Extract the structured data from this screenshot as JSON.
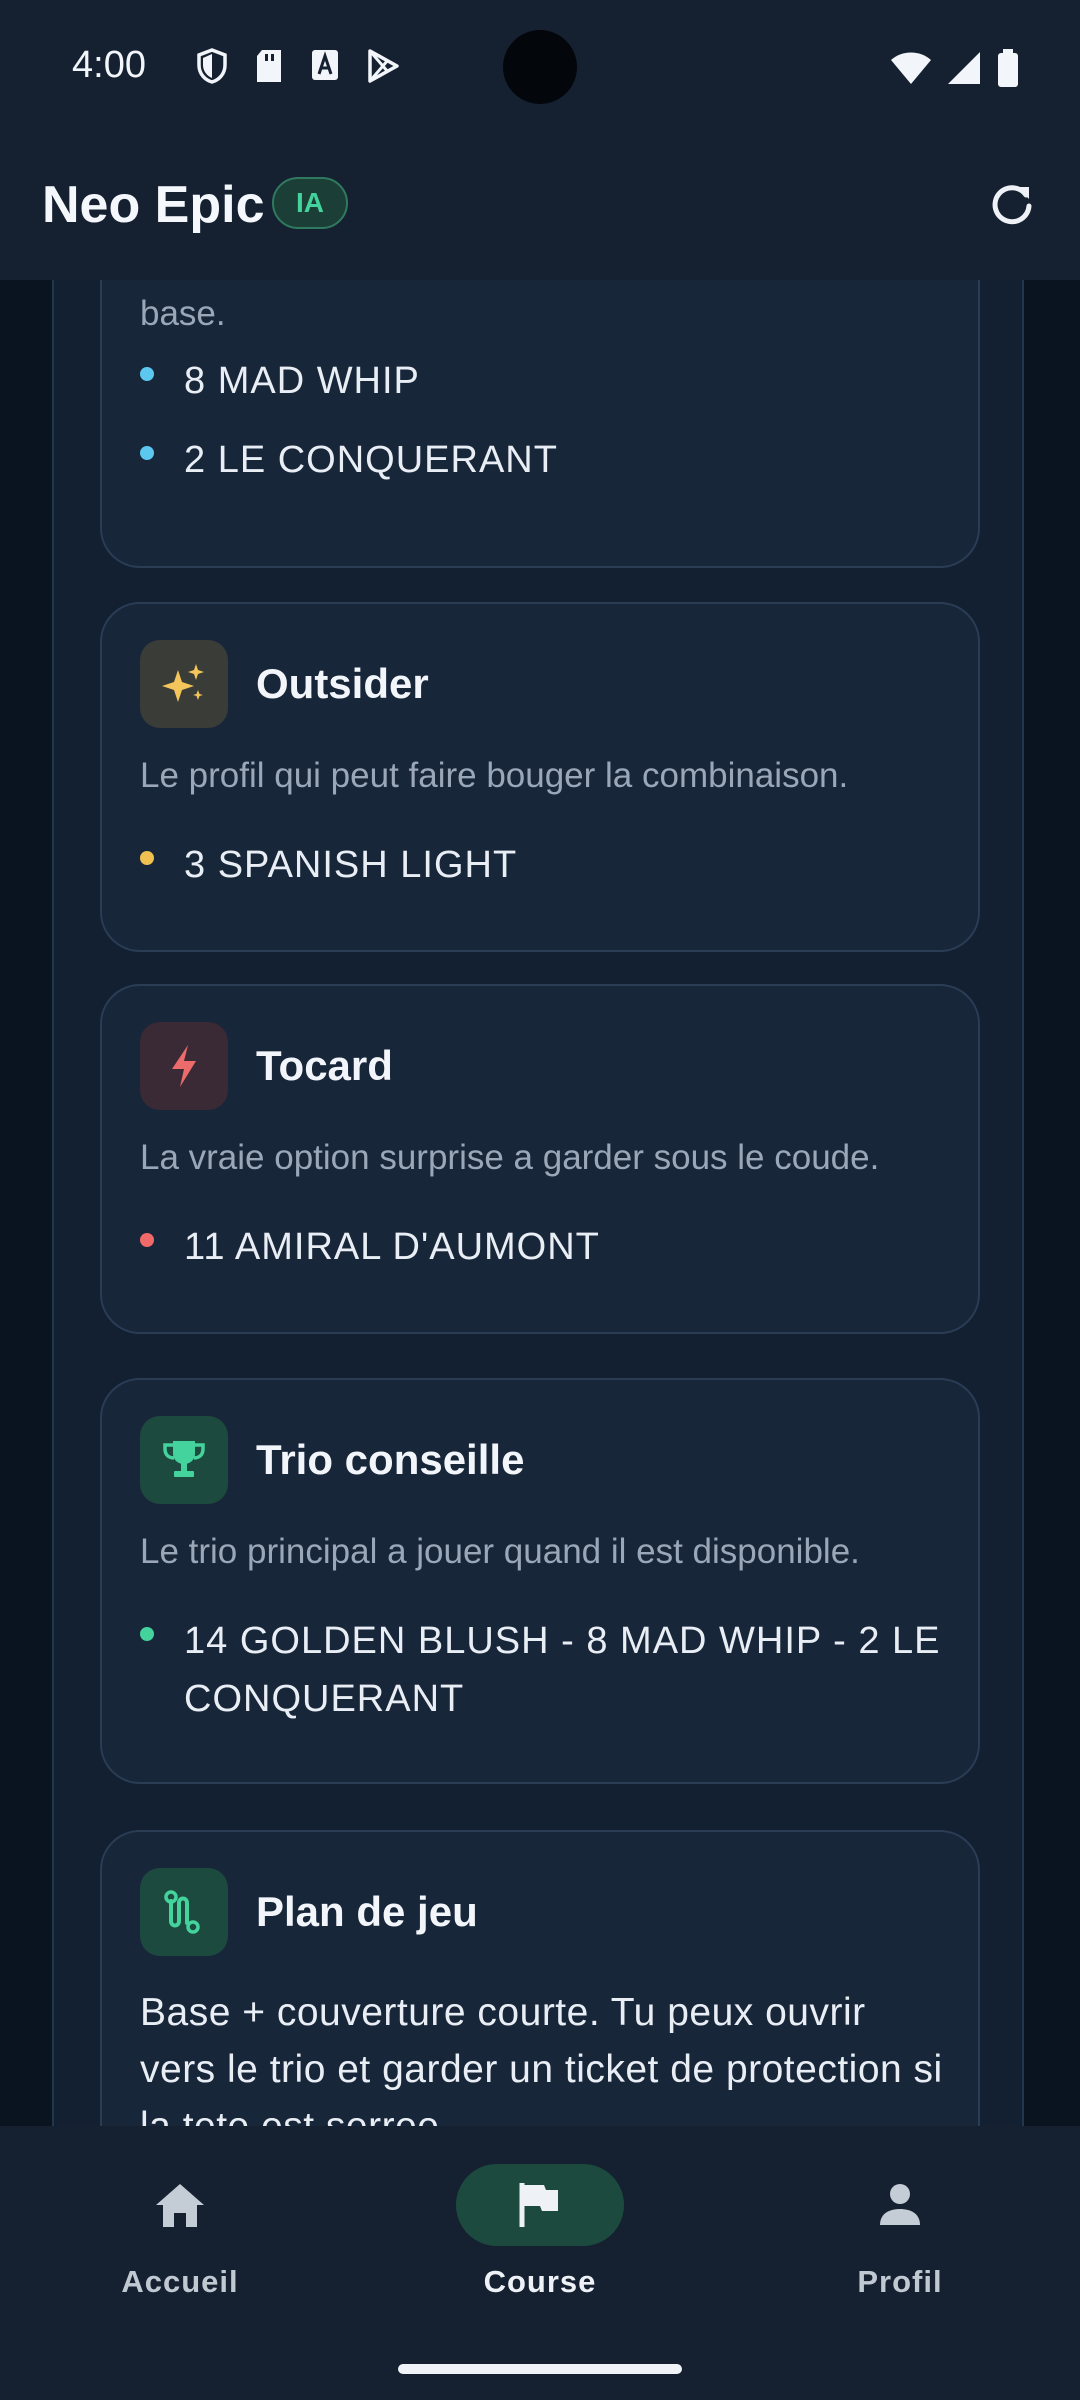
{
  "status_bar": {
    "time": "4:00"
  },
  "app_bar": {
    "title": "Neo Epic",
    "badge": "IA"
  },
  "cards": {
    "base": {
      "desc_partial": "base.",
      "bullets": [
        "8 MAD WHIP",
        "2 LE CONQUERANT"
      ],
      "dot_color": "#5cc8f0"
    },
    "outsider": {
      "title": "Outsider",
      "desc": "Le profil qui peut faire bouger la combinaison.",
      "bullets": [
        "3 SPANISH LIGHT"
      ],
      "dot_color": "#f0c050",
      "icon": "sparkles-icon"
    },
    "tocard": {
      "title": "Tocard",
      "desc": "La vraie option surprise a garder sous le coude.",
      "bullets": [
        "11 AMIRAL D'AUMONT"
      ],
      "dot_color": "#f06a6a",
      "icon": "lightning-icon"
    },
    "trio": {
      "title": "Trio conseille",
      "desc": "Le trio principal a jouer quand il est disponible.",
      "bullets": [
        "14 GOLDEN BLUSH - 8 MAD WHIP - 2 LE CONQUERANT"
      ],
      "dot_color": "#44d39c",
      "icon": "trophy-icon"
    },
    "plan": {
      "title": "Plan de jeu",
      "text": "Base + couverture courte. Tu peux ouvrir vers le trio et garder un ticket de protection si la tete est serree.",
      "icon": "route-icon"
    }
  },
  "bottom_nav": {
    "items": [
      {
        "label": "Accueil",
        "icon": "home-icon"
      },
      {
        "label": "Course",
        "icon": "flag-icon",
        "active": true
      },
      {
        "label": "Profil",
        "icon": "person-icon"
      }
    ]
  }
}
